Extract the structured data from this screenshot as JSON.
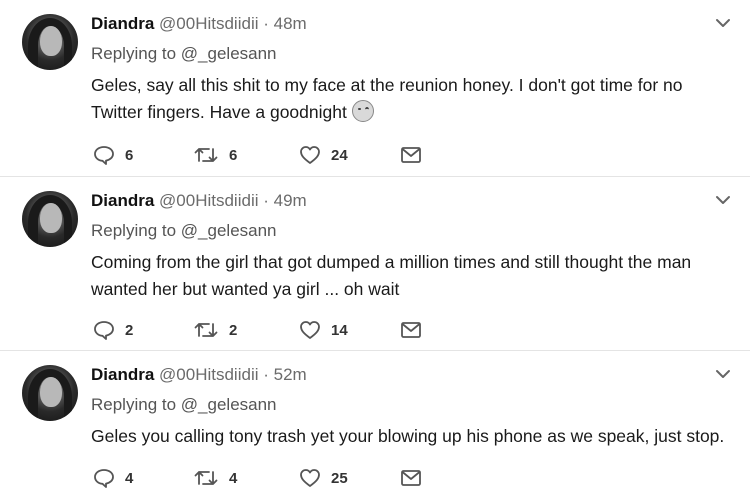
{
  "tweets": [
    {
      "name": "Diandra",
      "handle": "@00Hitsdiidii",
      "separator": "·",
      "time": "48m",
      "replying_prefix": "Replying to",
      "replying_to": "@_gelesann",
      "text": "Geles, say all this shit to my face at the reunion honey. I don't got time for no Twitter fingers. Have a goodnight",
      "emoji": "kissing-face-icon",
      "replies": "6",
      "retweets": "6",
      "likes": "24"
    },
    {
      "name": "Diandra",
      "handle": "@00Hitsdiidii",
      "separator": "·",
      "time": "49m",
      "replying_prefix": "Replying to",
      "replying_to": "@_gelesann",
      "text": "Coming from the girl that got dumped a million times and still thought the man wanted her but wanted ya girl ... oh wait",
      "replies": "2",
      "retweets": "2",
      "likes": "14"
    },
    {
      "name": "Diandra",
      "handle": "@00Hitsdiidii",
      "separator": "·",
      "time": "52m",
      "replying_prefix": "Replying to",
      "replying_to": "@_gelesann",
      "text": "Geles you calling tony trash yet your blowing up his phone as we speak, just stop.",
      "replies": "4",
      "retweets": "4",
      "likes": "25"
    }
  ]
}
